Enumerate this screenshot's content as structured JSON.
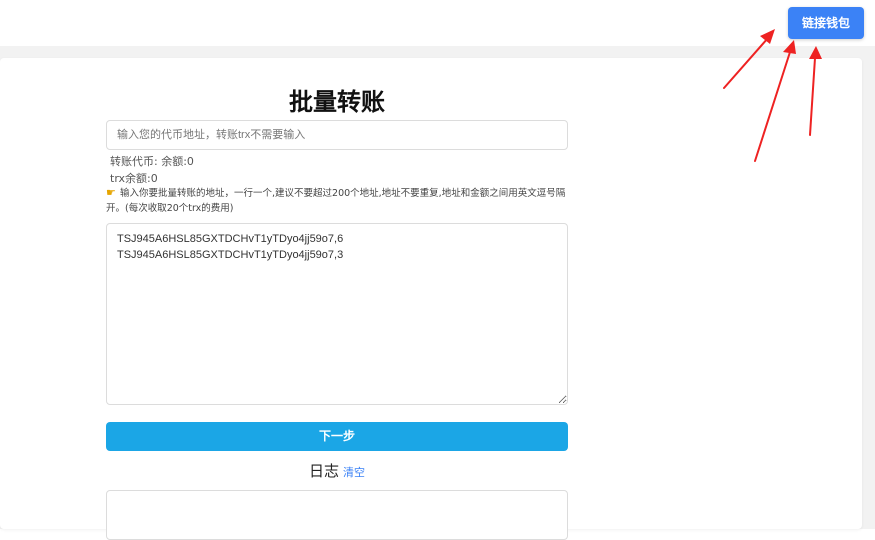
{
  "header": {
    "connect_wallet_label": "链接钱包"
  },
  "main": {
    "title": "批量转账",
    "token_input": {
      "placeholder": "输入您的代币地址，转账trx不需要输入",
      "value": ""
    },
    "token_balance_text": "转账代币: 余额:0",
    "trx_balance_text": "trx余额:0",
    "hint_icon": "pointing-hand-icon",
    "hint_text": "输入你要批量转账的地址，一行一个,建议不要超过200个地址,地址不要重复,地址和金额之间用英文逗号隔开。(每次收取20个trx的费用)",
    "addresses_textarea_value": "TSJ945A6HSL85GXTDCHvT1yTDyo4jj59o7,6\nTSJ945A6HSL85GXTDCHvT1yTDyo4jj59o7,3",
    "next_button_label": "下一步",
    "log_title": "日志",
    "log_clear_label": "清空"
  },
  "colors": {
    "primary_blue": "#3b82f6",
    "next_button": "#1ba6e6",
    "annotation_arrow": "#ee2222"
  }
}
